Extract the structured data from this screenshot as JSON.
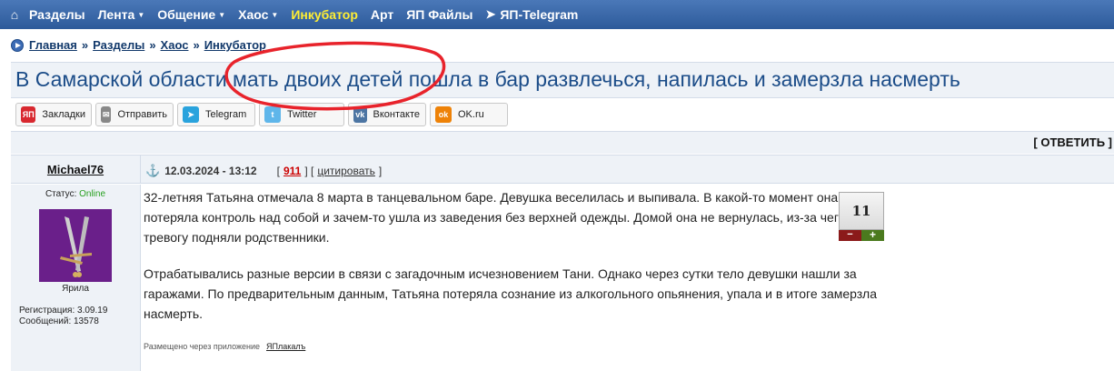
{
  "nav": {
    "home_icon": "home-icon",
    "items": [
      {
        "label": "Разделы",
        "dropdown": false,
        "active": false
      },
      {
        "label": "Лента",
        "dropdown": true,
        "active": false
      },
      {
        "label": "Общение",
        "dropdown": true,
        "active": false
      },
      {
        "label": "Хаос",
        "dropdown": true,
        "active": false
      },
      {
        "label": "Инкубатор",
        "dropdown": false,
        "active": true
      },
      {
        "label": "Арт",
        "dropdown": false,
        "active": false
      },
      {
        "label": "ЯП Файлы",
        "dropdown": false,
        "active": false
      },
      {
        "label": "ЯП-Telegram",
        "dropdown": false,
        "active": false
      }
    ],
    "active_color": "#ffee33"
  },
  "breadcrumb": [
    "Главная",
    "Разделы",
    "Хаос",
    "Инкубатор"
  ],
  "breadcrumb_sep": "»",
  "title": "В Самарской области мать двоих детей пошла в бар развлечься, напилась и замерзла насмерть",
  "share": [
    {
      "label": "Закладки",
      "icon": "yap-icon",
      "color": "#d8282f",
      "glyph": "ЯП"
    },
    {
      "label": "Отправить",
      "icon": "mail-icon",
      "color": "#888888",
      "glyph": "✉"
    },
    {
      "label": "Telegram",
      "icon": "telegram-icon",
      "color": "#2aa3dd",
      "glyph": "➤"
    },
    {
      "label": "Twitter",
      "icon": "twitter-icon",
      "color": "#5fb6ea",
      "glyph": "t"
    },
    {
      "label": "Вконтакте",
      "icon": "vk-icon",
      "color": "#4c75a3",
      "glyph": "vk"
    },
    {
      "label": "OK.ru",
      "icon": "ok-icon",
      "color": "#ee8208",
      "glyph": "ok"
    }
  ],
  "reply_label": "[ ОТВЕТИТЬ ]",
  "post": {
    "author": "Michael76",
    "date": "12.03.2024 - 13:12",
    "comment_count": "911",
    "cite_label": "цитировать",
    "status_label": "Статус:",
    "status_value": "Online",
    "avatar_caption": "Ярила",
    "registration": "Регистрация: 3.09.19",
    "messages": "Сообщений: 13578",
    "paragraphs": [
      "32-летняя Татьяна отмечала 8 марта в танцевальном баре. Девушка веселилась и выпивала. В какой-то момент она потеряла контроль над собой и зачем-то ушла из заведения без верхней одежды. Домой она не вернулась, из-за чего тревогу подняли родственники.",
      "Отрабатывались разные версии в связи с загадочным исчезновением Тани. Однако через сутки тело девушки нашли за гаражами. По предварительным данным, Татьяна потеряла сознание из алкогольного опьянения, упала и в итоге замерзла насмерть."
    ],
    "via_text": "Размещено через приложение",
    "via_app": "ЯПлакалъ",
    "rating": "11",
    "rating_minus": "−",
    "rating_plus": "+"
  }
}
